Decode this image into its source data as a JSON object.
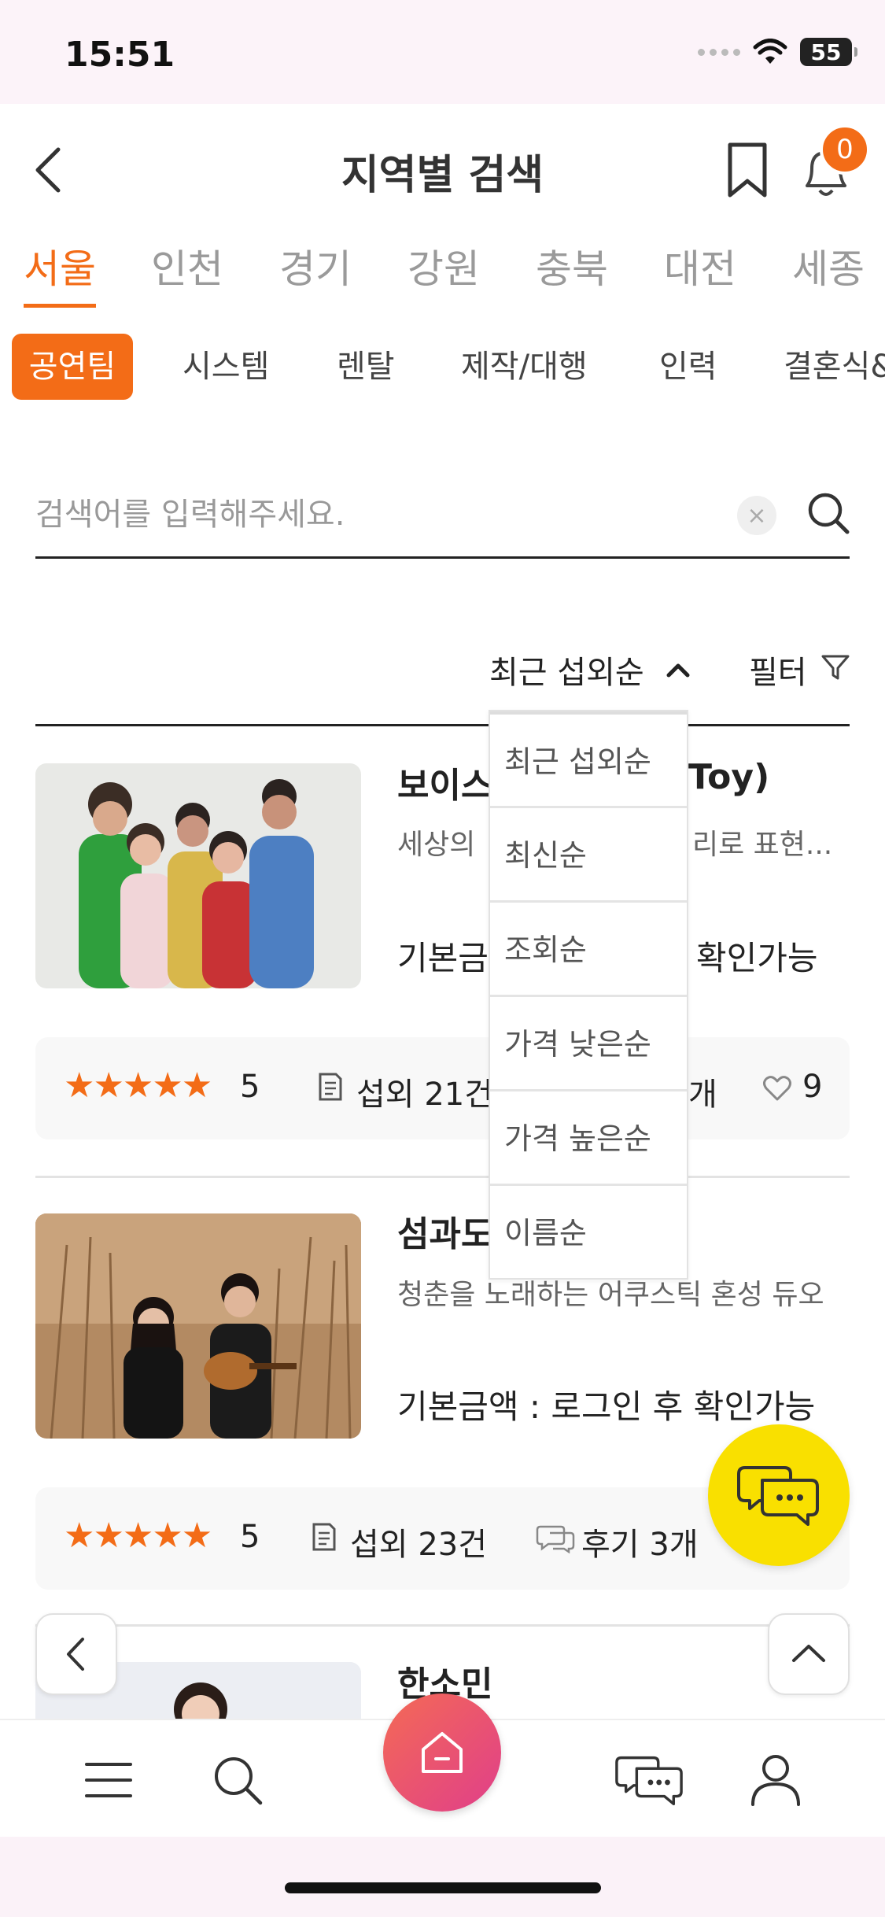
{
  "status_bar": {
    "time": "15:51",
    "battery": "55"
  },
  "header": {
    "title": "지역별 검색",
    "notification_count": "0"
  },
  "regions": [
    "서울",
    "인천",
    "경기",
    "강원",
    "충북",
    "대전",
    "세종"
  ],
  "categories": [
    "공연팀",
    "시스템",
    "렌탈",
    "제작/대행",
    "인력",
    "결혼식&"
  ],
  "search": {
    "placeholder": "검색어를 입력해주세요.",
    "clear": "×"
  },
  "sort": {
    "selected": "최근 섭외순",
    "filter_label": "필터"
  },
  "sort_options": [
    "최근 섭외순",
    "최신순",
    "조회순",
    "가격 낮은순",
    "가격 높은순",
    "이름순"
  ],
  "listings": [
    {
      "title_visible_left": "보이스",
      "title_visible_right": "Toy)",
      "desc_visible_left": "세상의",
      "desc_visible_right": "리로 표현...",
      "price_visible_left": "기본금",
      "price_visible_right": "확인가능",
      "stars": "★★★★★",
      "rating": "5",
      "bookings": "섭외 21건",
      "reviews_visible": "개",
      "likes": "9"
    },
    {
      "title_visible": "섬과도",
      "desc": "청춘을 노래하는 어쿠스틱 혼성 듀오",
      "price": "기본금액 : 로그인 후 확인가능",
      "stars": "★★★★★",
      "rating": "5",
      "bookings": "섭외 23건",
      "reviews": "후기 3개"
    },
    {
      "title": "한소민"
    }
  ],
  "colors": {
    "accent": "#f36c17",
    "chat_fab": "#f9e000",
    "home_gradient_start": "#f46a55",
    "home_gradient_end": "#e03f8a"
  },
  "icons": [
    "back-icon",
    "bookmark-icon",
    "bell-icon",
    "search-icon",
    "filter-icon",
    "chevron-up-icon",
    "chat-icon",
    "menu-icon",
    "home-icon",
    "user-icon"
  ]
}
